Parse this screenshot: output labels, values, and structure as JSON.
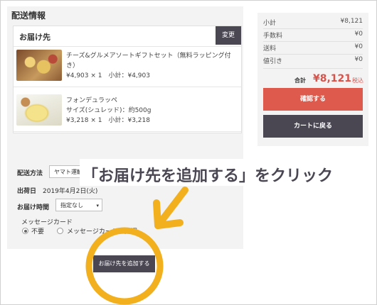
{
  "left": {
    "section_title": "配送情報",
    "ship_to_label": "お届け先",
    "change_label": "変更",
    "items": [
      {
        "name": "チーズ&グルメアソートギフトセット（無料ラッピング付き）",
        "line2": "",
        "price_line": "¥4,903 × 1　小計：¥4,903"
      },
      {
        "name": "フォンデュラッペ",
        "line2": "サイズ(シュレッド)：約500g",
        "price_line": "¥3,218 × 1　小計：¥3,218"
      }
    ],
    "delivery_method_label": "配送方法",
    "delivery_method_value": "ヤマト運輸",
    "ship_date_label": "出荷日",
    "ship_date_value": "2019年4月2日(火)",
    "delivery_time_label": "お届け時間",
    "delivery_time_value": "指定なし",
    "message_card_label": "メッセージカード",
    "radio_none": "不要",
    "radio_message": "メッセージカードを同梱",
    "add_address_button": "お届け先を追加する"
  },
  "summary": {
    "rows": [
      {
        "label": "小計",
        "value": "¥8,121"
      },
      {
        "label": "手数料",
        "value": "¥0"
      },
      {
        "label": "送料",
        "value": "¥0"
      },
      {
        "label": "値引き",
        "value": "¥0"
      }
    ],
    "total_label": "合計",
    "total_value": "¥8,121",
    "tax_label": "税込",
    "confirm_button": "確認する",
    "back_button": "カートに戻る"
  },
  "annotation": {
    "text": "「お届け先を追加する」をクリック"
  },
  "colors": {
    "accent": "#dd5a4c",
    "dark_button": "#4a4652",
    "highlight": "#f2b01e"
  }
}
